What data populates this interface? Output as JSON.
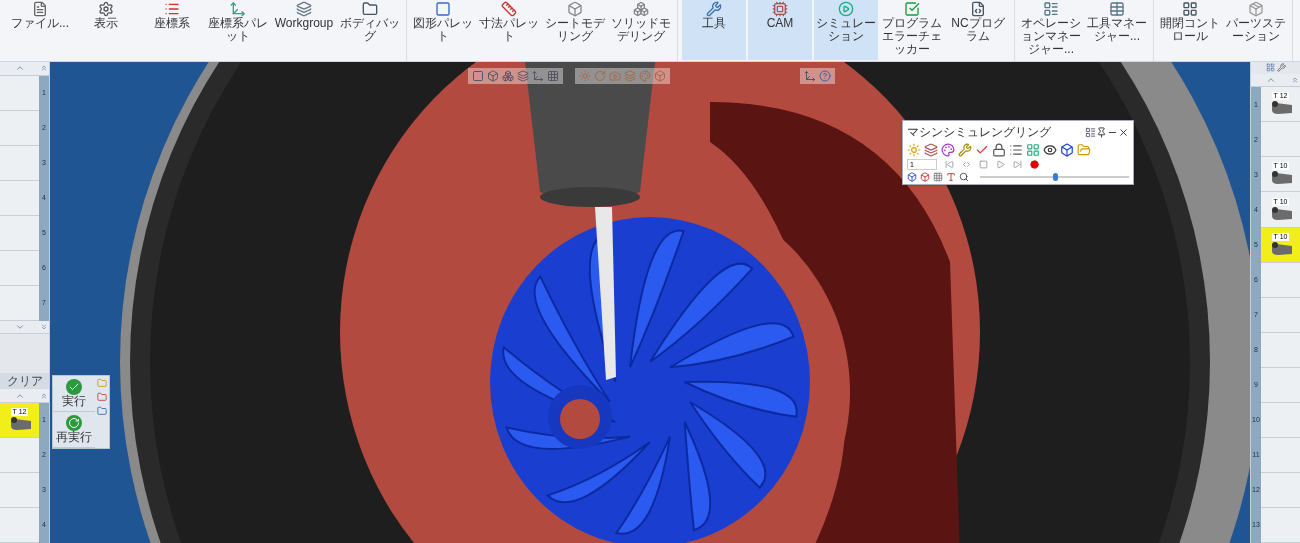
{
  "ribbon": {
    "groups": [
      {
        "buttons": [
          {
            "label": "ファイル...",
            "selected": false
          },
          {
            "label": "表示",
            "selected": false
          },
          {
            "label": "座標系",
            "selected": false
          },
          {
            "label": "座標系パレット",
            "selected": false
          },
          {
            "label": "Workgroup",
            "selected": false
          },
          {
            "label": "ボディバッグ",
            "selected": false
          }
        ]
      },
      {
        "buttons": [
          {
            "label": "図形パレット",
            "selected": false
          },
          {
            "label": "寸法パレット",
            "selected": false
          },
          {
            "label": "シートモデリング",
            "selected": false
          },
          {
            "label": "ソリッドモデリング",
            "selected": false
          }
        ]
      },
      {
        "buttons": [
          {
            "label": "工具",
            "selected": true
          },
          {
            "label": "CAM",
            "selected": true
          },
          {
            "label": "シミュレーション",
            "selected": true
          },
          {
            "label": "プログラムエラーチェッカー",
            "selected": false
          },
          {
            "label": "NCプログラム",
            "selected": false
          }
        ]
      },
      {
        "buttons": [
          {
            "label": "オペレーションマネージャー...",
            "selected": false
          },
          {
            "label": "工具マネージャー...",
            "selected": false
          }
        ]
      },
      {
        "buttons": [
          {
            "label": "開閉コントロール",
            "selected": false
          },
          {
            "label": "パーツステーション",
            "selected": false
          }
        ]
      }
    ]
  },
  "left_magazine": {
    "slots": [
      {
        "number": "1"
      },
      {
        "number": "2"
      },
      {
        "number": "3"
      },
      {
        "number": "4"
      },
      {
        "number": "5"
      },
      {
        "number": "6"
      },
      {
        "number": "7"
      }
    ]
  },
  "left_actions": {
    "clear": "クリア",
    "buttons": [
      "実行",
      "再実行"
    ]
  },
  "left_turret": {
    "slots": [
      {
        "number": "1",
        "tool": "T 12",
        "selected": true
      },
      {
        "number": "2",
        "selected": false
      },
      {
        "number": "3",
        "selected": false
      },
      {
        "number": "4",
        "selected": false
      }
    ]
  },
  "right_turret": {
    "slots": [
      {
        "number": "1",
        "tool": "T 12",
        "selected": false
      },
      {
        "number": "2",
        "selected": false
      },
      {
        "number": "3",
        "tool": "T 10",
        "selected": false
      },
      {
        "number": "4",
        "tool": "T 10",
        "selected": false
      },
      {
        "number": "5",
        "tool": "T 10",
        "selected": true
      },
      {
        "number": "6",
        "selected": false
      },
      {
        "number": "7",
        "selected": false
      },
      {
        "number": "8",
        "selected": false
      },
      {
        "number": "9",
        "selected": false
      },
      {
        "number": "10",
        "selected": false
      },
      {
        "number": "11",
        "selected": false
      },
      {
        "number": "12",
        "selected": false
      },
      {
        "number": "13",
        "selected": false
      }
    ]
  },
  "sim_window": {
    "title": "マシンシミュレングリング",
    "step": "1",
    "level": 0.5
  }
}
